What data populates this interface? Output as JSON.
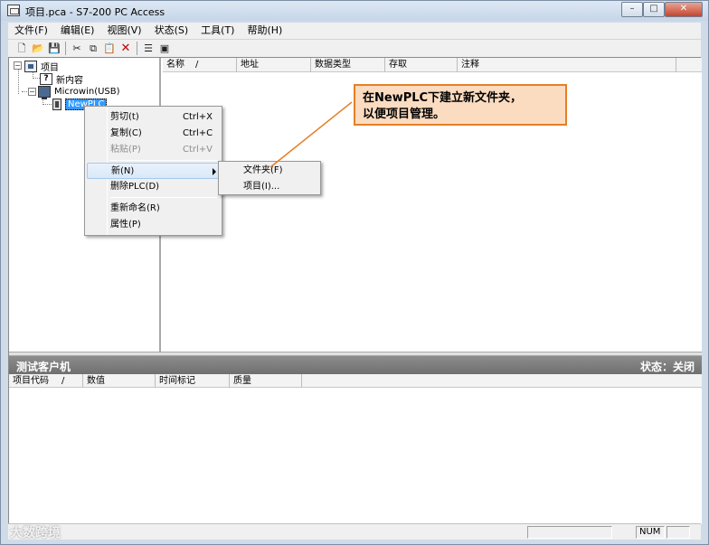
{
  "window": {
    "title": "项目.pca - S7-200 PC Access"
  },
  "menubar": [
    "文件(F)",
    "编辑(E)",
    "视图(V)",
    "状态(S)",
    "工具(T)",
    "帮助(H)"
  ],
  "toolbar": {
    "new_icon": "document-new-icon",
    "open_icon": "folder-open-icon",
    "save_icon": "save-icon",
    "cut_icon": "scissors-icon",
    "copy_icon": "copy-icon",
    "paste_icon": "paste-icon",
    "delete_icon": "red-x-icon",
    "delete_glyph": "✕",
    "items_icon": "items-list-icon",
    "monitor_icon": "monitor-icon"
  },
  "tree": {
    "root": "项目",
    "new_item": "新内容",
    "connection": "Microwin(USB)",
    "plc": "NewPLC"
  },
  "list_columns": [
    "名称",
    "/",
    "地址",
    "数据类型",
    "存取",
    "注释"
  ],
  "test_client": {
    "title": "测试客户机",
    "status": "状态：关闭"
  },
  "bottom_columns": [
    "项目代码",
    "/",
    "数值",
    "时间标记",
    "质量"
  ],
  "context_menu": {
    "cut": {
      "label": "剪切(t)",
      "key": "Ctrl+X"
    },
    "copy": {
      "label": "复制(C)",
      "key": "Ctrl+C"
    },
    "paste": {
      "label": "粘贴(P)",
      "key": "Ctrl+V"
    },
    "new": {
      "label": "新(N)"
    },
    "delete": {
      "label": "删除PLC(D)"
    },
    "rename": {
      "label": "重新命名(R)"
    },
    "properties": {
      "label": "属性(P)"
    }
  },
  "submenu": {
    "folder": "文件夹(F)",
    "item": "项目(I)..."
  },
  "callout": {
    "line1": "在NewPLC下建立新文件夹，",
    "line2": "以便项目管理。"
  },
  "statusbar": {
    "num": "NUM"
  },
  "watermark": "大数跨境",
  "colors": {
    "callout_border": "#e57f26",
    "callout_fill": "#fbdcc0",
    "selection": "#3399ff",
    "test_bar": "#7a7a7a"
  }
}
